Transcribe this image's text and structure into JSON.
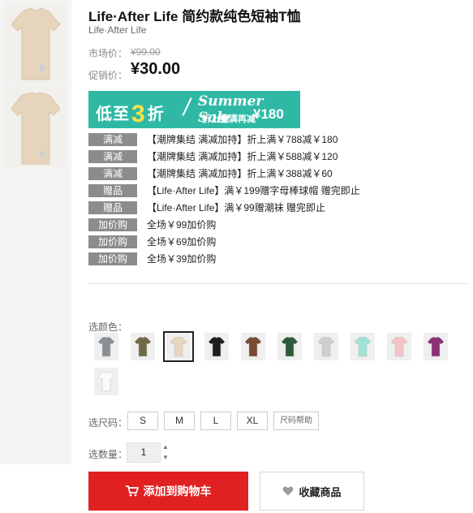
{
  "product": {
    "title": "Life·After Life 简约款纯色短袖T恤",
    "brand": "Life·After Life",
    "market_price_label": "市场价：",
    "market_price": "¥99.00",
    "promo_price_label": "促销价：",
    "promo_price": "¥30.00"
  },
  "banner": {
    "prefix": "低至",
    "number": "3",
    "suffix": "折",
    "slash": "/",
    "title": "Summer Sale",
    "subtitle": "折上叠满再减",
    "amount": "¥180"
  },
  "promotions": [
    {
      "tag": "满减",
      "text": "【潮牌集结 满减加持】折上满￥788减￥180"
    },
    {
      "tag": "满减",
      "text": "【潮牌集结 满减加持】折上满￥588减￥120"
    },
    {
      "tag": "满减",
      "text": "【潮牌集结 满减加持】折上满￥388减￥60"
    },
    {
      "tag": "赠品",
      "text": "【Life·After Life】满￥199赠字母棒球帽 赠完即止"
    },
    {
      "tag": "赠品",
      "text": "【Life·After Life】满￥99赠潮袜 赠完即止"
    },
    {
      "tag": "加价购",
      "text": "全场￥99加价购"
    },
    {
      "tag": "加价购",
      "text": "全场￥69加价购"
    },
    {
      "tag": "加价购",
      "text": "全场￥39加价购"
    }
  ],
  "color_selector": {
    "label": "选颜色：",
    "swatches": [
      {
        "name": "gray",
        "color": "#8a8f95"
      },
      {
        "name": "olive",
        "color": "#6d6a45"
      },
      {
        "name": "beige",
        "color": "#e8d6bf",
        "selected": true
      },
      {
        "name": "black",
        "color": "#1e1e1e"
      },
      {
        "name": "brown",
        "color": "#7a4a32"
      },
      {
        "name": "dark-green",
        "color": "#2c5a3a"
      },
      {
        "name": "light-gray",
        "color": "#cfcfcf"
      },
      {
        "name": "mint",
        "color": "#9fe3d6"
      },
      {
        "name": "pink",
        "color": "#f5c4c8"
      },
      {
        "name": "purple",
        "color": "#8c2f74"
      },
      {
        "name": "white",
        "color": "#fafafa"
      }
    ]
  },
  "size_selector": {
    "label": "选尺码：",
    "sizes": [
      "S",
      "M",
      "L",
      "XL"
    ],
    "help_label": "尺码帮助"
  },
  "quantity": {
    "label": "选数量：",
    "value": "1"
  },
  "actions": {
    "add_to_cart": "添加到购物车",
    "favorite": "收藏商品"
  },
  "thumbnails": [
    {
      "color": "#e8d6bf"
    },
    {
      "color": "#e8d6bf"
    }
  ]
}
